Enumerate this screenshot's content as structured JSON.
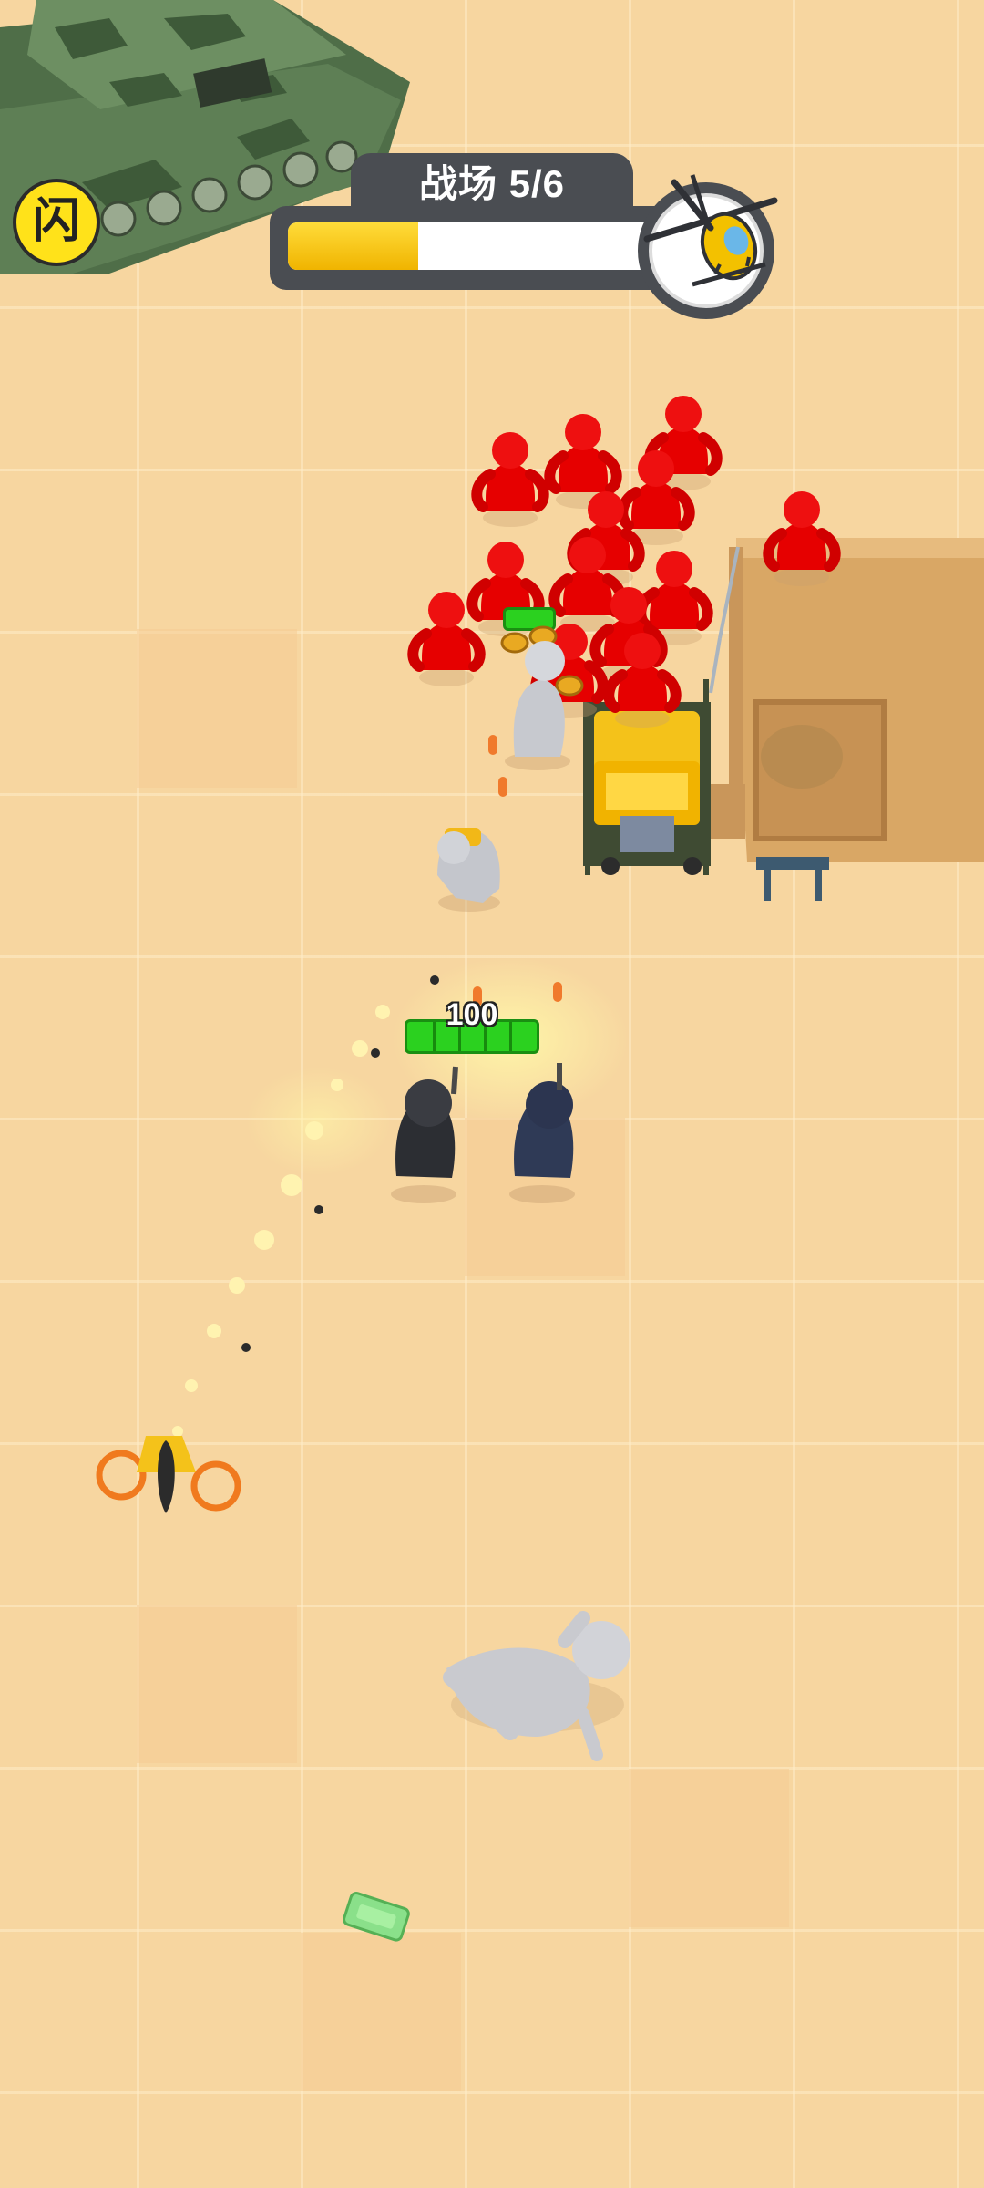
{
  "hud": {
    "level_label": "战场 5/6",
    "progress_fraction": 0.34
  },
  "flash_badge": {
    "glyph": "闪"
  },
  "squad": {
    "health_value": "100"
  },
  "colors": {
    "progress_fill": "#f5c200",
    "enemy": "#e60000",
    "hp_green": "#2bd11f",
    "hud_dark": "#4a4d52"
  },
  "icons": [
    "flash-badge-icon",
    "helicopter-icon",
    "tank-icon"
  ]
}
